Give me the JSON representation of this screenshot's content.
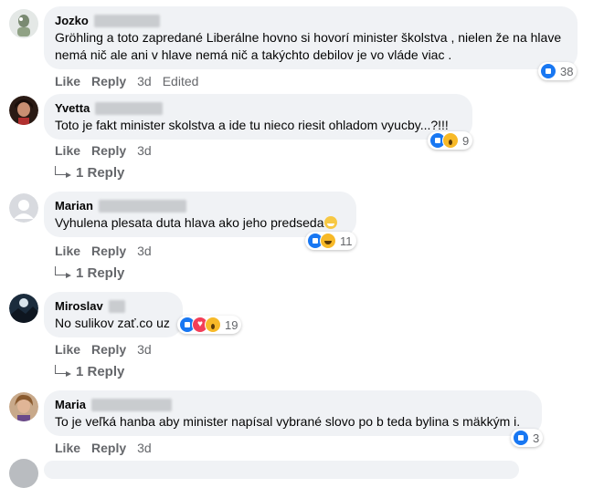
{
  "comments": [
    {
      "author": "Jozko",
      "text": "Gröhling a toto zapredané Liberálne hovno si hovorí minister školstva , nielen že na hlave nemá nič ale ani v hlave nemá nič a takýchto debilov je vo vláde viac .",
      "reactions": [
        "like"
      ],
      "reaction_count": "38",
      "like_label": "Like",
      "reply_label": "Reply",
      "time": "3d",
      "edited": "Edited"
    },
    {
      "author": "Yvetta",
      "text": "Toto je fakt minister skolstva a ide tu nieco riesit ohladom vyucby...?!!!",
      "reactions": [
        "like",
        "wow"
      ],
      "reaction_count": "9",
      "like_label": "Like",
      "reply_label": "Reply",
      "time": "3d",
      "replies_link": "1 Reply"
    },
    {
      "author": "Marian",
      "text": "Vyhulena plesata duta hlava ako jeho predseda",
      "emoji": "grinning-face-emoji",
      "reactions": [
        "like",
        "haha"
      ],
      "reaction_count": "11",
      "like_label": "Like",
      "reply_label": "Reply",
      "time": "3d",
      "replies_link": "1 Reply"
    },
    {
      "author": "Miroslav",
      "text": "No sulikov zať.co uz",
      "reactions": [
        "like",
        "love",
        "wow"
      ],
      "reaction_count": "19",
      "like_label": "Like",
      "reply_label": "Reply",
      "time": "3d",
      "replies_link": "1 Reply"
    },
    {
      "author": "Maria",
      "text": "To je veľká hanba aby minister napísal vybrané slovo po b teda bylina s mäkkým i.",
      "reactions": [
        "like"
      ],
      "reaction_count": "3",
      "like_label": "Like",
      "reply_label": "Reply",
      "time": "3d"
    }
  ],
  "colors": {
    "bubble": "#f0f2f5",
    "secondary_text": "#65676b",
    "like_blue": "#1877f2",
    "love_red": "#f33e58",
    "wow_yellow": "#f7b928"
  }
}
